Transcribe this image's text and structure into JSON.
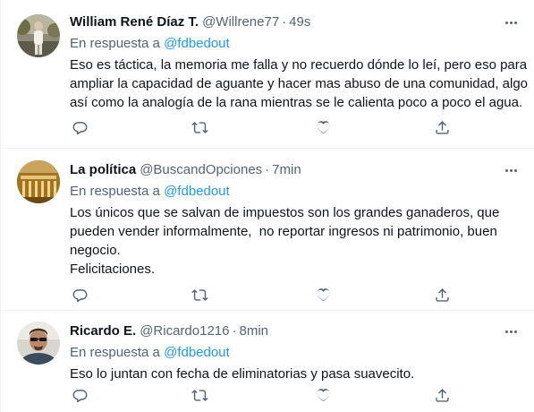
{
  "colors": {
    "text": "#0f1419",
    "secondary": "#536471",
    "accent": "#1d9bf0",
    "divider": "#eff3f4"
  },
  "tweets": [
    {
      "name": "William René Díaz T.",
      "handle": "@Willrene77",
      "separator": "·",
      "time": "49s",
      "reply_prefix": "En respuesta a",
      "reply_to": "@fdbedout",
      "lines": [
        "Eso es táctica, la memoria me falla y no recuerdo dónde lo leí, pero eso para",
        "ampliar la capacidad de aguante y hacer mas abuso de una comunidad, algo",
        "así como la analogía de la rana mientras se le calienta poco a poco el agua."
      ],
      "avatar_icon": "person-outdoor-avatar"
    },
    {
      "name": "La política",
      "handle": "@BuscandOpciones",
      "separator": "·",
      "time": "7min",
      "reply_prefix": "En respuesta a",
      "reply_to": "@fdbedout",
      "lines": [
        "Los únicos que se salvan de impuestos son los grandes ganaderos, que",
        "pueden vender informalmente,  no reportar ingresos ni patrimonio, buen",
        "negocio.",
        "Felicitaciones."
      ],
      "avatar_icon": "golden-building-avatar"
    },
    {
      "name": "Ricardo E.",
      "handle": "@Ricardo1216",
      "separator": "·",
      "time": "8min",
      "reply_prefix": "En respuesta a",
      "reply_to": "@fdbedout",
      "lines": [
        "Eso lo juntan con fecha de eliminatorias y pasa suavecito."
      ],
      "avatar_icon": "man-sunglasses-avatar"
    }
  ],
  "action_icons": [
    "reply-icon",
    "retweet-icon",
    "like-icon",
    "share-icon"
  ]
}
